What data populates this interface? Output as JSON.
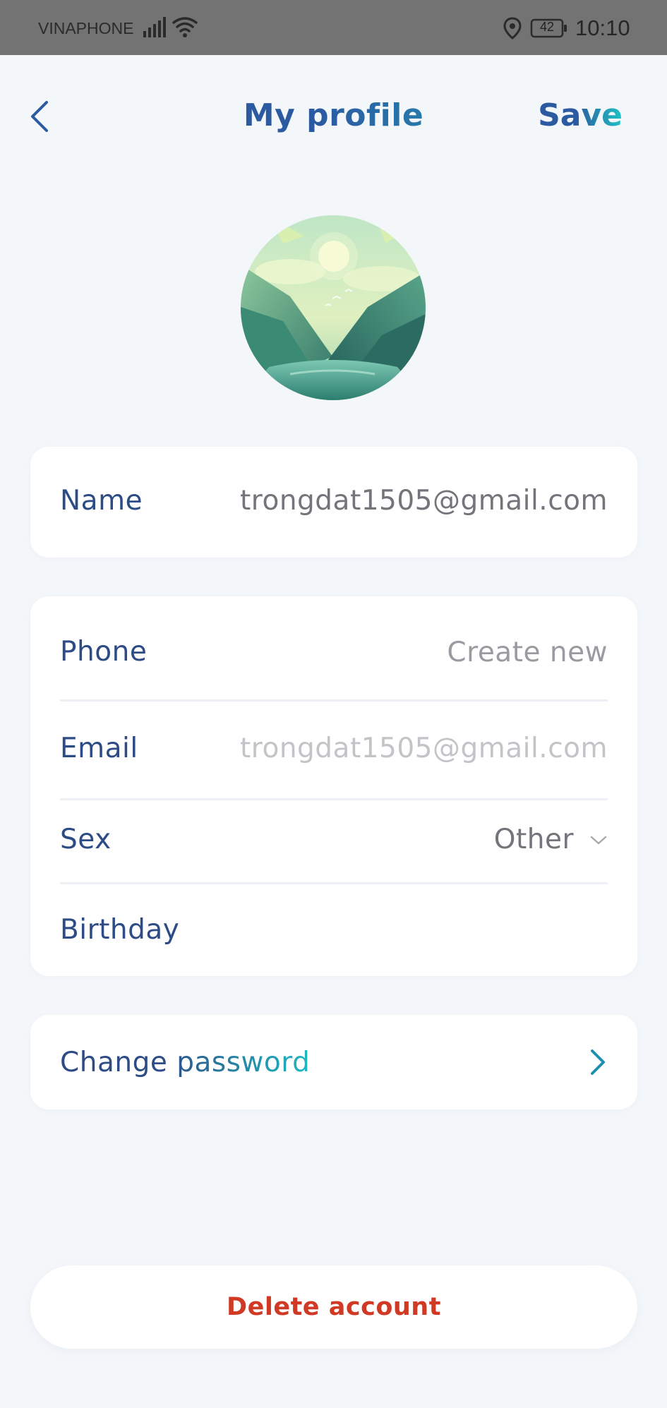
{
  "status_bar": {
    "carrier": "VINAPHONE",
    "battery": "42",
    "time": "10:10"
  },
  "header": {
    "title": "My profile",
    "save_label": "Save"
  },
  "profile": {
    "name_label": "Name",
    "name_value": "trongdat1505@gmail.com"
  },
  "details": {
    "phone_label": "Phone",
    "phone_value": "Create new",
    "email_label": "Email",
    "email_value": "trongdat1505@gmail.com",
    "sex_label": "Sex",
    "sex_value": "Other",
    "birthday_label": "Birthday",
    "birthday_value": ""
  },
  "security": {
    "change_password_label": "Change password"
  },
  "actions": {
    "delete_label": "Delete account"
  },
  "colors": {
    "label": "#2d4c86",
    "accent_start": "#2b5aa0",
    "accent_end": "#1ec2c4",
    "danger": "#d03a24",
    "background": "#f4f7fa"
  }
}
